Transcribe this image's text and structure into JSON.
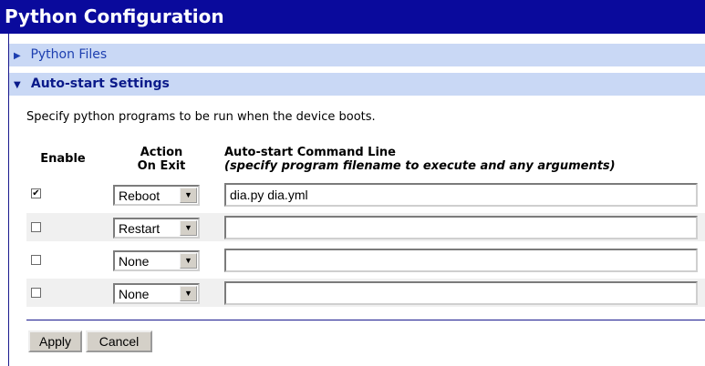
{
  "page": {
    "title": "Python Configuration",
    "sections": {
      "files": "Python Files",
      "autostart": "Auto-start Settings"
    },
    "description": "Specify python programs to be run when the device boots.",
    "table": {
      "headers": {
        "enable": "Enable",
        "action_line1": "Action",
        "action_line2": "On Exit",
        "cmd_line1": "Auto-start Command Line",
        "cmd_line2": "(specify program filename to execute and any arguments)"
      },
      "rows": [
        {
          "enabled": true,
          "checkbox_mark": "✔",
          "action": "Reboot",
          "command": "dia.py dia.yml"
        },
        {
          "enabled": false,
          "checkbox_mark": "",
          "action": "Restart",
          "command": ""
        },
        {
          "enabled": false,
          "checkbox_mark": "",
          "action": "None",
          "command": ""
        },
        {
          "enabled": false,
          "checkbox_mark": "",
          "action": "None",
          "command": ""
        }
      ]
    },
    "buttons": {
      "apply": "Apply",
      "cancel": "Cancel"
    }
  }
}
